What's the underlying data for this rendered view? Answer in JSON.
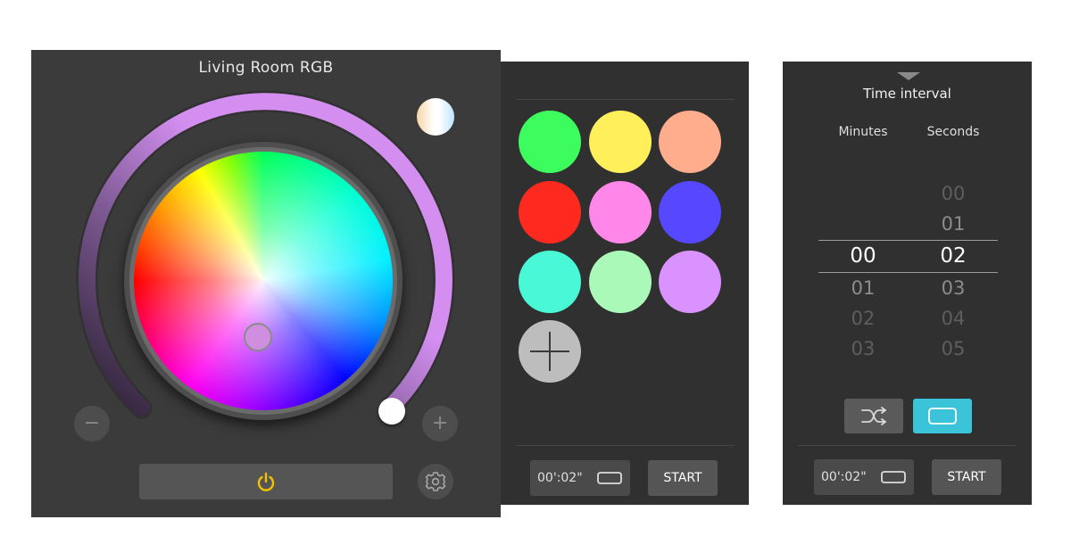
{
  "rgb_panel": {
    "title": "Living Room RGB",
    "minus_label": "−",
    "plus_label": "+",
    "brightness_arc_color": "#d38ef0",
    "selected_color": "#d08ee0",
    "icons": [
      "white-light-icon",
      "power-icon",
      "gear-icon"
    ],
    "power_icon_color": "#f2c200"
  },
  "swatch_panel": {
    "swatches": [
      {
        "color": "#3dfc5e"
      },
      {
        "color": "#ffef5a"
      },
      {
        "color": "#ffad8c"
      },
      {
        "color": "#ff2a1f"
      },
      {
        "color": "#ff87ea"
      },
      {
        "color": "#5548ff"
      },
      {
        "color": "#48f8d6"
      },
      {
        "color": "#aaf9b9"
      },
      {
        "color": "#d992ff"
      }
    ],
    "add_icon": "plus-icon",
    "footer": {
      "time": "00':02\"",
      "loop_icon": "loop-icon",
      "start_label": "START"
    }
  },
  "interval_panel": {
    "title": "Time interval",
    "minutes_header": "Minutes",
    "seconds_header": "Seconds",
    "minutes": {
      "selected": "00",
      "after": [
        "01",
        "02",
        "03"
      ]
    },
    "seconds": {
      "before": [
        "00",
        "01"
      ],
      "selected": "02",
      "after": [
        "03",
        "04",
        "05"
      ]
    },
    "modes": [
      {
        "icon": "shuffle-icon",
        "active": false
      },
      {
        "icon": "loop-icon",
        "active": true
      }
    ],
    "active_color": "#3bc3d9",
    "footer": {
      "time": "00':02\"",
      "loop_icon": "loop-icon",
      "start_label": "START"
    }
  }
}
